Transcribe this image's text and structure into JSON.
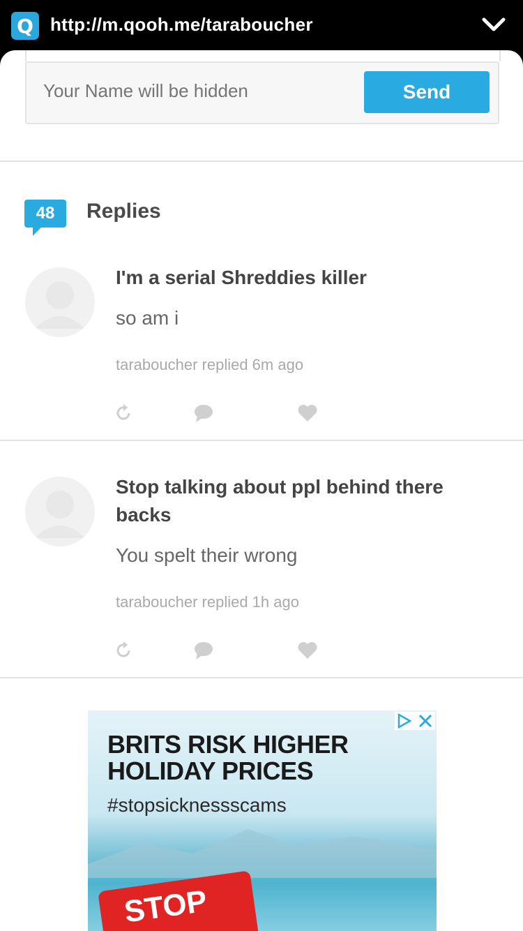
{
  "browser": {
    "logo_letter": "Q",
    "url": "http://m.qooh.me/taraboucher"
  },
  "form": {
    "name_placeholder": "Your Name will be hidden",
    "send_label": "Send"
  },
  "replies": {
    "count": "48",
    "title": "Replies",
    "items": [
      {
        "question": "I'm a serial Shreddies killer",
        "answer": "so am i",
        "meta": "taraboucher replied 6m ago"
      },
      {
        "question": "Stop talking about ppl behind there backs",
        "answer": "You spelt their wrong",
        "meta": "taraboucher replied 1h ago"
      }
    ]
  },
  "ad": {
    "line1": "BRITS RISK HIGHER",
    "line2": "HOLIDAY PRICES",
    "hashtag": "#stopsicknessscams",
    "sign_text": "STOP"
  },
  "colors": {
    "accent": "#29abe2",
    "topbar": "#000000",
    "icon_gray": "#cfcfcf"
  }
}
